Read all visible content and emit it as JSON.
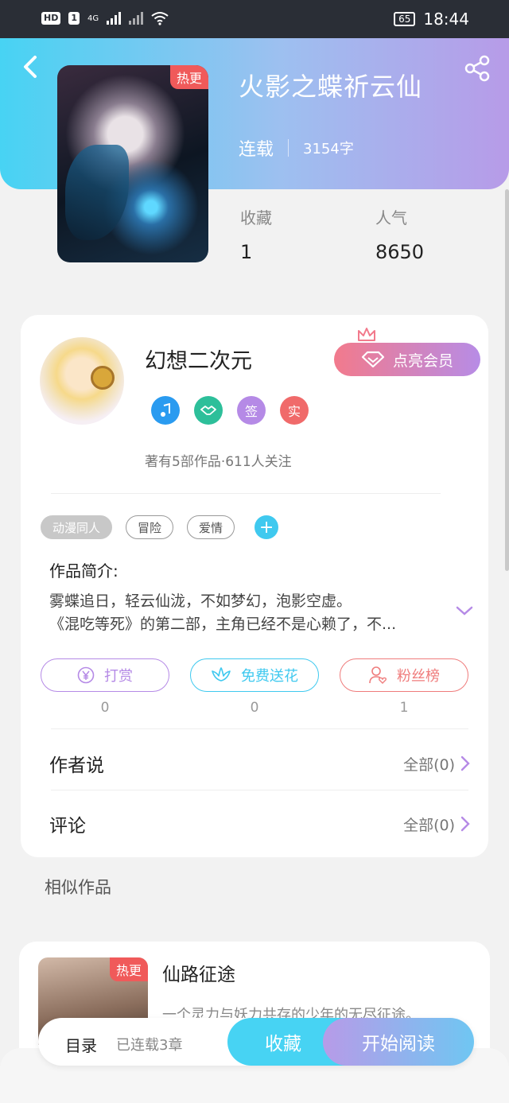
{
  "status_bar": {
    "network_badge": "HD",
    "sim_badge": "1",
    "signal_label": "4G",
    "battery": "65",
    "time": "18:44"
  },
  "book": {
    "title": "火影之蝶祈云仙",
    "badge": "热更",
    "status": "连载",
    "word_count": "3154字",
    "stats": [
      {
        "label": "收藏",
        "value": "1"
      },
      {
        "label": "人气",
        "value": "8650"
      }
    ]
  },
  "author": {
    "name": "幻想二次元",
    "vip_button": "点亮会员",
    "badges": [
      {
        "icon": "music-badge-icon",
        "color": "#2a9bf0"
      },
      {
        "icon": "handshake-badge-icon",
        "color": "#2dbf9a"
      },
      {
        "text": "签",
        "color": "#b58ae6"
      },
      {
        "text": "实",
        "color": "#f06a6a"
      }
    ],
    "summary": "著有5部作品·611人关注"
  },
  "tags": [
    "动漫同人",
    "冒险",
    "爱情"
  ],
  "intro": {
    "title": "作品简介:",
    "line1": "雾蝶追日，轻云仙泷，不如梦幻，泡影空虚。",
    "line2": "《混吃等死》的第二部，主角已经不是心赖了，不..."
  },
  "actions": [
    {
      "label": "打赏",
      "count": "0",
      "color": "#b58ae6"
    },
    {
      "label": "免费送花",
      "count": "0",
      "color": "#3fc9ef"
    },
    {
      "label": "粉丝榜",
      "count": "1",
      "color": "#ef7c7c"
    }
  ],
  "sections": [
    {
      "title": "作者说",
      "link": "全部(0)"
    },
    {
      "title": "评论",
      "link": "全部(0)"
    }
  ],
  "similar": {
    "heading": "相似作品",
    "items": [
      {
        "title": "仙路征途",
        "badge": "热更",
        "desc": "一个灵力与妖力共存的少年的无尽征途。"
      }
    ]
  },
  "bottom_bar": {
    "toc": "目录",
    "chapters": "已连载3章",
    "favorite": "收藏",
    "read": "开始阅读"
  }
}
